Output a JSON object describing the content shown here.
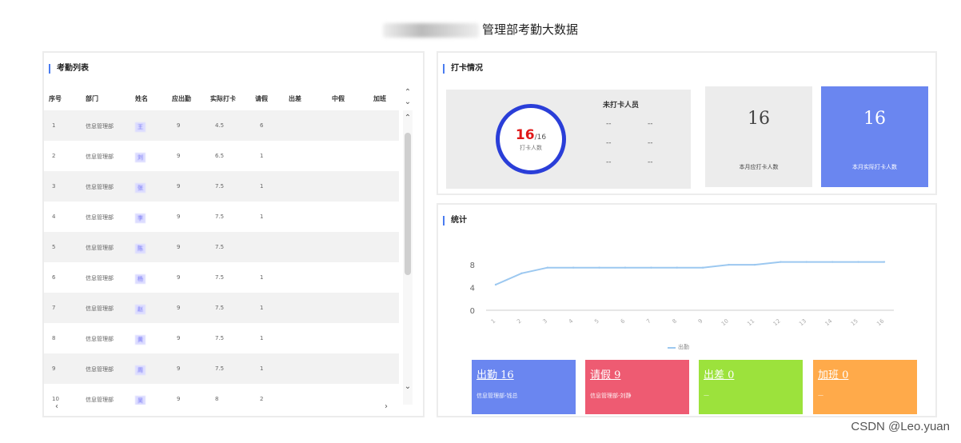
{
  "page": {
    "title": "管理部考勤大数据"
  },
  "attendance_list": {
    "title": "考勤列表",
    "columns": [
      "序号",
      "部门",
      "姓名",
      "应出勤",
      "实际打卡",
      "请假",
      "出差",
      "中假",
      "加班"
    ],
    "rows": [
      {
        "no": "1",
        "dept": "信息管理部",
        "name": "王",
        "due": "9",
        "actual": "4.5",
        "leave": "6"
      },
      {
        "no": "2",
        "dept": "信息管理部",
        "name": "刘",
        "due": "9",
        "actual": "6.5",
        "leave": "1"
      },
      {
        "no": "3",
        "dept": "信息管理部",
        "name": "张",
        "due": "9",
        "actual": "7.5",
        "leave": "1"
      },
      {
        "no": "4",
        "dept": "信息管理部",
        "name": "李",
        "due": "9",
        "actual": "7.5",
        "leave": "1"
      },
      {
        "no": "5",
        "dept": "信息管理部",
        "name": "陈",
        "due": "9",
        "actual": "7.5",
        "leave": ""
      },
      {
        "no": "6",
        "dept": "信息管理部",
        "name": "杨",
        "due": "9",
        "actual": "7.5",
        "leave": "1"
      },
      {
        "no": "7",
        "dept": "信息管理部",
        "name": "赵",
        "due": "9",
        "actual": "7.5",
        "leave": "1"
      },
      {
        "no": "8",
        "dept": "信息管理部",
        "name": "黄",
        "due": "9",
        "actual": "7.5",
        "leave": "1"
      },
      {
        "no": "9",
        "dept": "信息管理部",
        "name": "周",
        "due": "9",
        "actual": "7.5",
        "leave": "1"
      },
      {
        "no": "10",
        "dept": "信息管理部",
        "name": "吴",
        "due": "9",
        "actual": "8",
        "leave": "2"
      }
    ]
  },
  "clock_in": {
    "title": "打卡情况",
    "ring_value": "16",
    "ring_total": "/16",
    "ring_label": "打卡人数",
    "progress_fraction": 1.0,
    "unpunched_title": "未打卡人员",
    "unpunched": [
      "--",
      "--",
      "--",
      "--",
      "--",
      "--"
    ],
    "total_count": "16",
    "total_label": "本月应打卡人数",
    "actual_count": "16",
    "actual_label": "本月实际打卡人数"
  },
  "statistics": {
    "title": "统计",
    "legend": "出勤",
    "cards": [
      {
        "title": "出勤 16",
        "sub": "信息管理部-钱总",
        "color": "#6a86f0"
      },
      {
        "title": "请假 9",
        "sub": "信息管理部-刘静",
        "color": "#ee5b72"
      },
      {
        "title": "出差 0",
        "sub": "—",
        "color": "#9ce23c"
      },
      {
        "title": "加班 0",
        "sub": "—",
        "color": "#ffaa4a"
      }
    ]
  },
  "chart_data": {
    "type": "line",
    "x": [
      "1",
      "2",
      "3",
      "4",
      "5",
      "6",
      "7",
      "8",
      "9",
      "10",
      "11",
      "12",
      "13",
      "14",
      "15",
      "16"
    ],
    "series": [
      {
        "name": "出勤",
        "values": [
          4.5,
          6.5,
          7.5,
          7.5,
          7.5,
          7.5,
          7.5,
          7.5,
          7.5,
          8,
          8,
          8.5,
          8.5,
          8.5,
          8.5,
          8.5
        ]
      }
    ],
    "yticks": [
      "0",
      "4",
      "8"
    ],
    "ylim": [
      0,
      9
    ],
    "grid": false,
    "legend_position": "bottom",
    "line_color": "#9cc8f0"
  },
  "watermark": "CSDN @Leo.yuan"
}
